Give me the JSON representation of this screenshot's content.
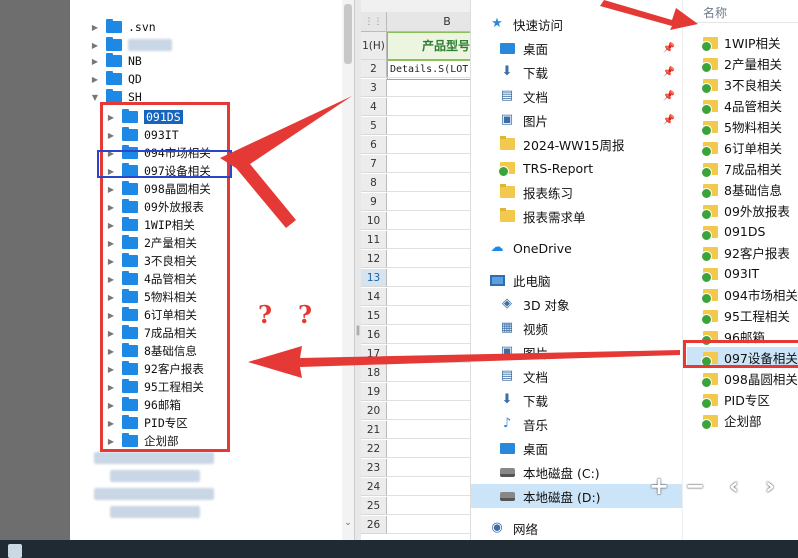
{
  "tree": {
    "items": [
      {
        "label": ".svn",
        "expanded": false
      },
      {
        "label": "",
        "blurred": true
      },
      {
        "label": "NB",
        "expanded": false
      },
      {
        "label": "QD",
        "expanded": false
      },
      {
        "label": "SH",
        "expanded": true
      },
      {
        "label": "091DS",
        "selected": true
      },
      {
        "label": "093IT"
      },
      {
        "label": "094市场相关"
      },
      {
        "label": "097设备相关"
      },
      {
        "label": "098晶圆相关"
      },
      {
        "label": "09外放报表"
      },
      {
        "label": "1WIP相关"
      },
      {
        "label": "2产量相关"
      },
      {
        "label": "3不良相关"
      },
      {
        "label": "4品管相关"
      },
      {
        "label": "5物料相关"
      },
      {
        "label": "6订单相关"
      },
      {
        "label": "7成品相关"
      },
      {
        "label": "8基础信息"
      },
      {
        "label": "92客户报表"
      },
      {
        "label": "95工程相关"
      },
      {
        "label": "96邮箱"
      },
      {
        "label": "PID专区"
      },
      {
        "label": "企划部"
      }
    ]
  },
  "sheet": {
    "column_header": "B",
    "row1_header": "1(H)",
    "cell_b1": "产品型号",
    "cell_b2": "Details.S(LOT",
    "row_numbers": [
      "2",
      "3",
      "4",
      "5",
      "6",
      "7",
      "8",
      "9",
      "10",
      "11",
      "12",
      "13",
      "14",
      "15",
      "16",
      "17",
      "18",
      "19",
      "20",
      "21",
      "22",
      "23",
      "24",
      "25",
      "26"
    ],
    "active_row": "13"
  },
  "explorer": {
    "nav_items": [
      {
        "label": "快速访问",
        "icon": "star-icon",
        "color": "#2b88d8"
      },
      {
        "label": "桌面",
        "icon": "desktop-icon",
        "pinned": true
      },
      {
        "label": "下载",
        "icon": "download-icon",
        "pinned": true
      },
      {
        "label": "文档",
        "icon": "document-icon",
        "pinned": true
      },
      {
        "label": "图片",
        "icon": "picture-icon",
        "pinned": true
      },
      {
        "label": "2024-WW15周报",
        "icon": "folder-icon"
      },
      {
        "label": "TRS-Report",
        "icon": "synced-folder-icon"
      },
      {
        "label": "报表练习",
        "icon": "folder-icon"
      },
      {
        "label": "报表需求单",
        "icon": "folder-icon"
      },
      {
        "label": "OneDrive",
        "icon": "cloud-icon"
      },
      {
        "label": "此电脑",
        "icon": "computer-icon"
      },
      {
        "label": "3D 对象",
        "icon": "3d-objects-icon"
      },
      {
        "label": "视频",
        "icon": "video-icon"
      },
      {
        "label": "图片",
        "icon": "picture-icon"
      },
      {
        "label": "文档",
        "icon": "document-icon"
      },
      {
        "label": "下载",
        "icon": "download-icon"
      },
      {
        "label": "音乐",
        "icon": "music-icon"
      },
      {
        "label": "桌面",
        "icon": "desktop-icon"
      },
      {
        "label": "本地磁盘 (C:)",
        "icon": "drive-icon"
      },
      {
        "label": "本地磁盘 (D:)",
        "icon": "drive-icon",
        "selected": true
      },
      {
        "label": "网络",
        "icon": "network-icon"
      }
    ],
    "files_header": "名称",
    "files": [
      {
        "label": "1WIP相关"
      },
      {
        "label": "2产量相关"
      },
      {
        "label": "3不良相关"
      },
      {
        "label": "4品管相关"
      },
      {
        "label": "5物料相关"
      },
      {
        "label": "6订单相关"
      },
      {
        "label": "7成品相关"
      },
      {
        "label": "8基础信息"
      },
      {
        "label": "09外放报表"
      },
      {
        "label": "091DS"
      },
      {
        "label": "92客户报表"
      },
      {
        "label": "093IT"
      },
      {
        "label": "094市场相关"
      },
      {
        "label": "95工程相关"
      },
      {
        "label": "96邮箱"
      },
      {
        "label": "097设备相关",
        "selected": true
      },
      {
        "label": "098晶圆相关"
      },
      {
        "label": "PID专区"
      },
      {
        "label": "企划部"
      }
    ],
    "controls": {
      "add": "+",
      "remove": "−",
      "back": "‹",
      "forward": "›"
    }
  },
  "annotations": {
    "question_marks": [
      "?",
      "?"
    ],
    "arrow_color": "#e53935",
    "highlight_color": "#e53935",
    "focus_color": "#2a47c9"
  }
}
